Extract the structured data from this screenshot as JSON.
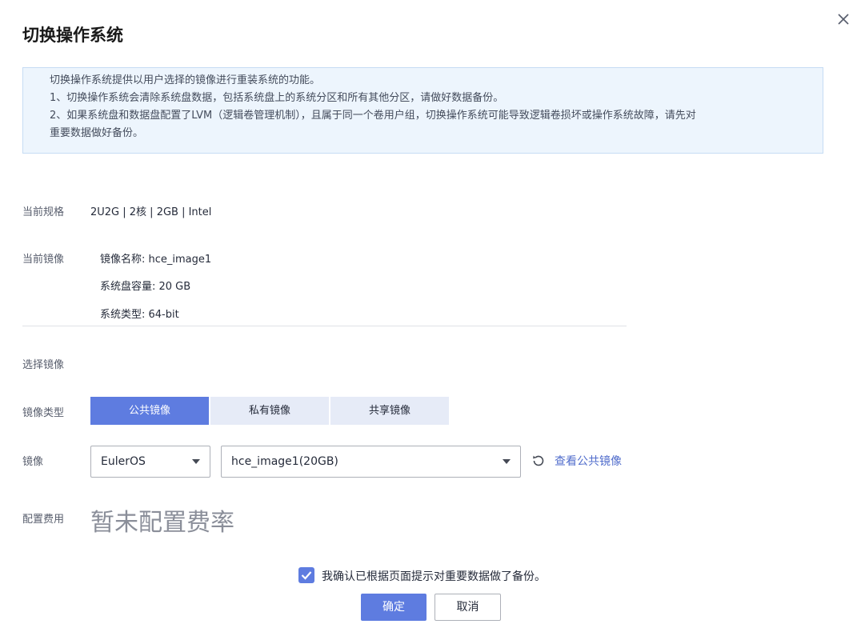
{
  "dialog": {
    "title": "切换操作系统"
  },
  "notice": {
    "lines": [
      "切换操作系统提供以用户选择的镜像进行重装系统的功能。",
      "1、切换操作系统会清除系统盘数据，包括系统盘上的系统分区和所有其他分区，请做好数据备份。",
      "2、如果系统盘和数据盘配置了LVM（逻辑卷管理机制），且属于同一个卷用户组，切换操作系统可能导致逻辑卷损坏或操作系统故障，请先对",
      "重要数据做好备份。"
    ]
  },
  "spec": {
    "label": "当前规格",
    "value": "2U2G | 2核 | 2GB | Intel"
  },
  "current_image": {
    "label": "当前镜像",
    "name": "镜像名称: hce_image1",
    "disk": "系统盘容量: 20 GB",
    "type": "系统类型: 64-bit"
  },
  "select_image": {
    "label": "选择镜像"
  },
  "image_type": {
    "label": "镜像类型",
    "tabs": [
      "公共镜像",
      "私有镜像",
      "共享镜像"
    ],
    "active_index": 0
  },
  "image": {
    "label": "镜像",
    "os_value": "EulerOS",
    "image_value": "hce_image1(20GB)",
    "view_public_link": "查看公共镜像"
  },
  "fee": {
    "label": "配置费用",
    "value": "暂未配置费率"
  },
  "confirm": {
    "checked": true,
    "text": "我确认已根据页面提示对重要数据做了备份。"
  },
  "buttons": {
    "ok": "确定",
    "cancel": "取消"
  },
  "colors": {
    "primary": "#5e7ce0",
    "link": "#526ecc",
    "notice_bg": "#edf5fd",
    "tab_bg": "#e6ebf7"
  }
}
